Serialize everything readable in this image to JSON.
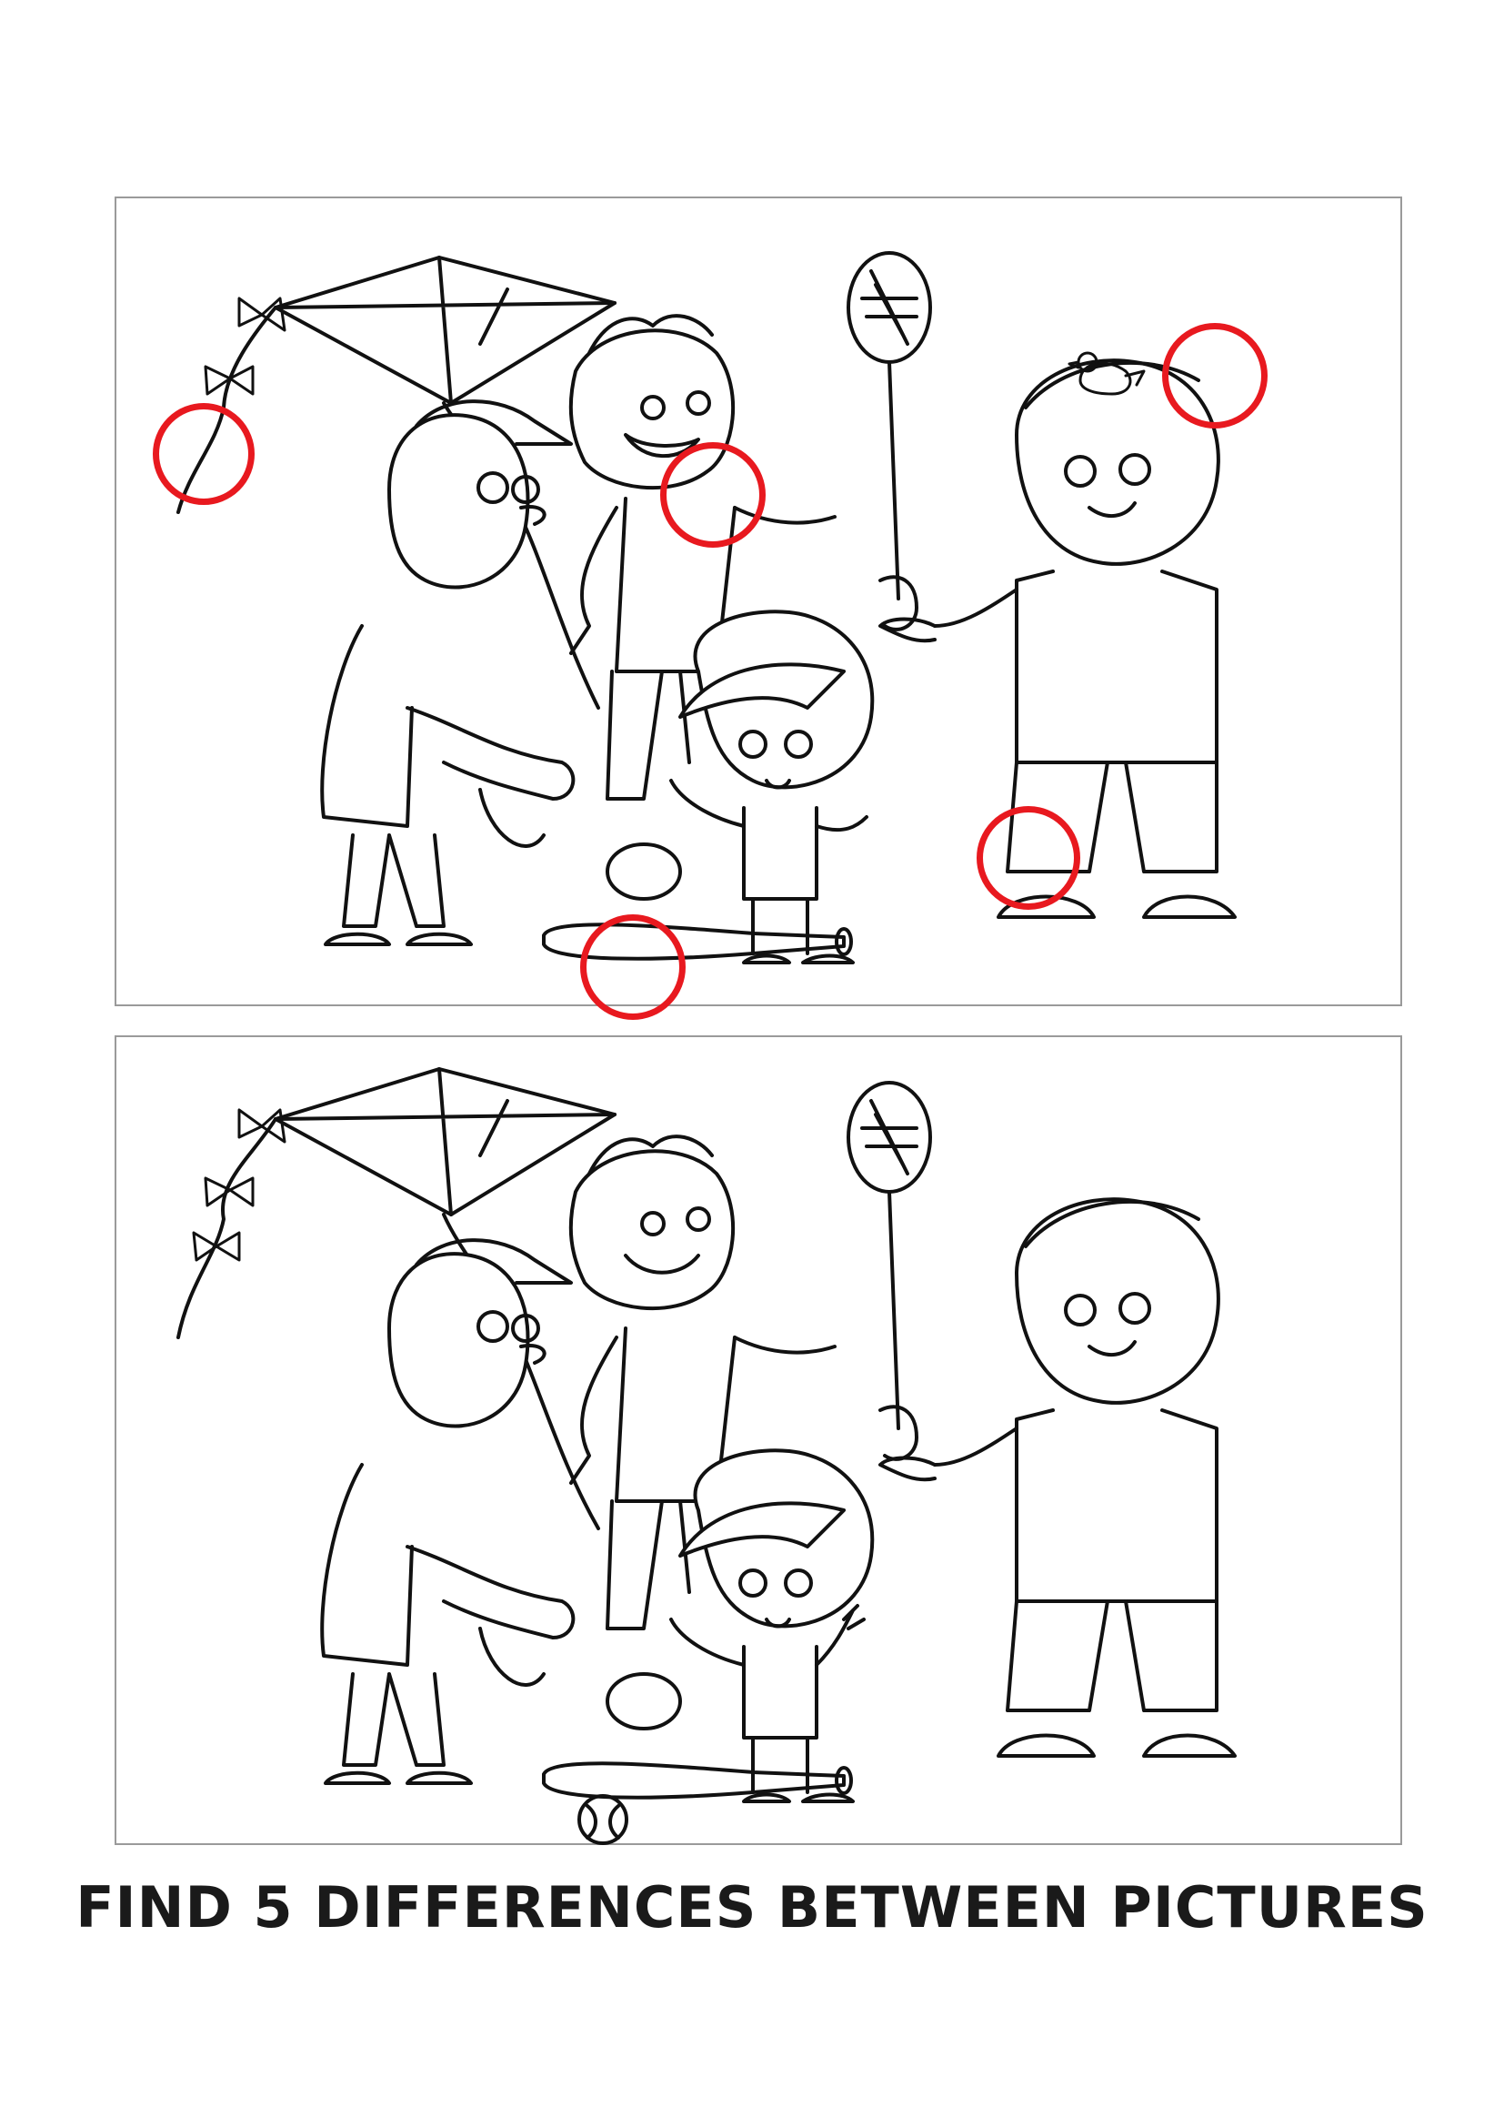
{
  "puzzle": {
    "title": "FIND 5 DIFFERENCES BETWEEN PICTURES",
    "marker_color": "#e8191f",
    "line_color": "#111111",
    "differences_found": 6
  },
  "panels": [
    {
      "id": "top",
      "variant": "modified",
      "shows_markers": true
    },
    {
      "id": "bottom",
      "variant": "original",
      "shows_markers": false
    }
  ]
}
